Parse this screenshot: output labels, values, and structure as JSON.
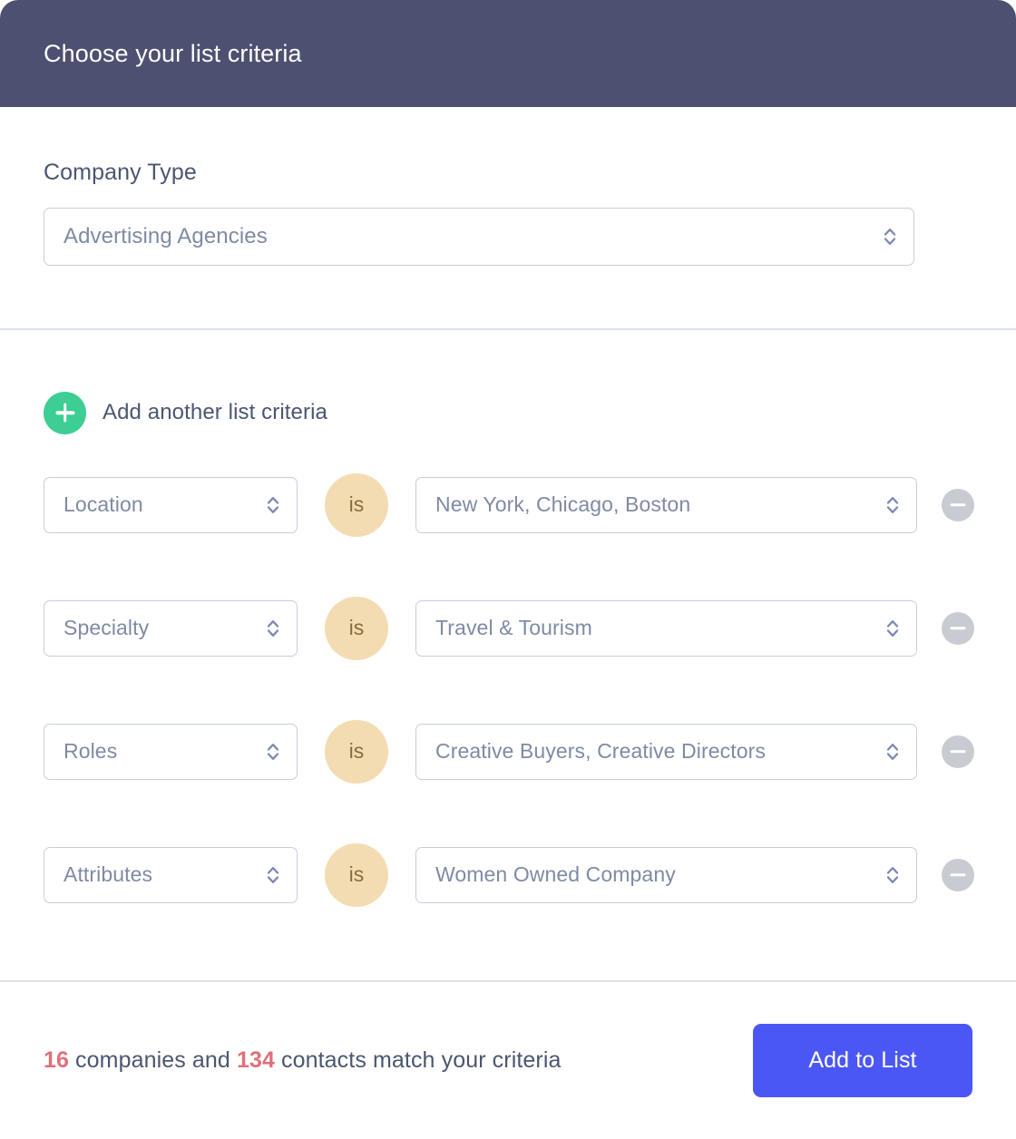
{
  "header": {
    "title": "Choose your list criteria",
    "background": "#4d5070",
    "text_color": "#ffffff"
  },
  "company_type": {
    "label": "Company Type",
    "value": "Advertising Agencies",
    "chevron_icon": "chevron-up-down-icon"
  },
  "add_criteria": {
    "label": "Add another list criteria",
    "icon": "plus-icon",
    "button_color": "#3dce93"
  },
  "criteria_rows": [
    {
      "field": "Location",
      "operator": "is",
      "value": "New York, Chicago, Boston",
      "remove_icon": "minus-icon"
    },
    {
      "field": "Specialty",
      "operator": "is",
      "value": "Travel & Tourism",
      "remove_icon": "minus-icon"
    },
    {
      "field": "Roles",
      "operator": "is",
      "value": "Creative Buyers, Creative Directors",
      "remove_icon": "minus-icon"
    },
    {
      "field": "Attributes",
      "operator": "is",
      "value": "Women Owned Company",
      "remove_icon": "minus-icon"
    }
  ],
  "footer": {
    "companies_count": "16",
    "companies_word": " companies and ",
    "contacts_count": "134",
    "contacts_suffix": " contacts match your criteria",
    "submit_label": "Add to List",
    "submit_color": "#4b57f5",
    "count_color": "#df707c"
  },
  "colors": {
    "select_border": "#c8cce0",
    "select_text": "#7f8aa3",
    "label_text": "#4b5670",
    "divider": "#dde1ec",
    "operator_badge_bg": "#f4dcb2",
    "operator_badge_text": "#8a6a3e",
    "remove_button_bg": "#c9cbd2"
  }
}
